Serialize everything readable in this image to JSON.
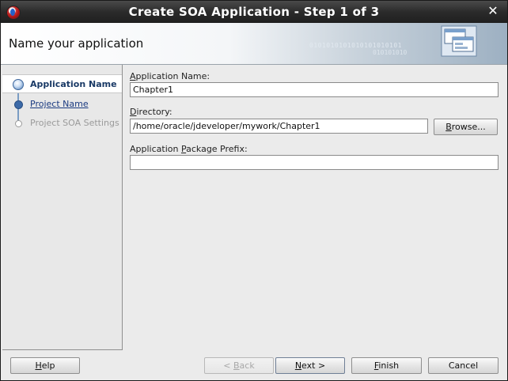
{
  "window": {
    "title": "Create SOA Application - Step 1 of 3",
    "close_glyph": "✕"
  },
  "header": {
    "title": "Name your application",
    "binary_text_1": "0101010101010101010101",
    "binary_text_2": "010101010"
  },
  "steps": [
    {
      "label": "Application Name",
      "state": "current"
    },
    {
      "label": "Project Name",
      "state": "link"
    },
    {
      "label": "Project SOA Settings",
      "state": "disabled"
    }
  ],
  "form": {
    "app_name_label_pre": "",
    "app_name_label_mn": "A",
    "app_name_label_post": "pplication Name:",
    "app_name_value": "Chapter1",
    "directory_label_pre": "",
    "directory_label_mn": "D",
    "directory_label_post": "irectory:",
    "directory_value": "/home/oracle/jdeveloper/mywork/Chapter1",
    "browse_pre": "",
    "browse_mn": "B",
    "browse_post": "rowse...",
    "prefix_label_pre": "Application ",
    "prefix_label_mn": "P",
    "prefix_label_post": "ackage Prefix:",
    "prefix_value": ""
  },
  "buttons": {
    "help": {
      "pre": "",
      "mn": "H",
      "post": "elp"
    },
    "back": {
      "pre": "< ",
      "mn": "B",
      "post": "ack"
    },
    "next": {
      "pre": "",
      "mn": "N",
      "post": "ext >"
    },
    "finish": {
      "pre": "",
      "mn": "F",
      "post": "inish"
    },
    "cancel": {
      "pre": "Cancel",
      "mn": "",
      "post": ""
    }
  },
  "colors": {
    "accent": "#1a3a66",
    "link": "#1a3a80",
    "titlebar": "#2b2b2b"
  }
}
